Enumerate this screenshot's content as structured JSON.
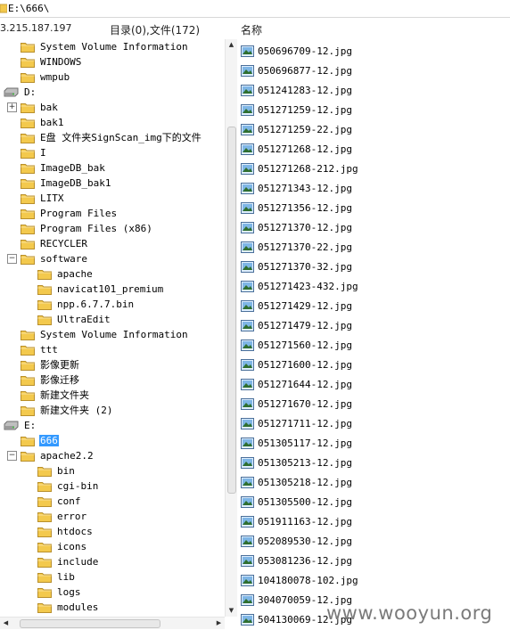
{
  "path_bar": {
    "path": "E:\\666\\"
  },
  "info": {
    "ip": "3.215.187.197",
    "dir_count": "目录(0),文件(172)",
    "column_name": "名称"
  },
  "tree": [
    {
      "label": "System Volume Information",
      "type": "folder",
      "level": 1
    },
    {
      "label": "WINDOWS",
      "type": "folder",
      "level": 1
    },
    {
      "label": "wmpub",
      "type": "folder",
      "level": 1
    },
    {
      "label": "D:",
      "type": "drive",
      "level": 0
    },
    {
      "label": "bak",
      "type": "folder",
      "level": 1,
      "expander": "+"
    },
    {
      "label": "bak1",
      "type": "folder",
      "level": 1
    },
    {
      "label": "E盘 文件夹SignScan_img下的文件",
      "type": "folder",
      "level": 1
    },
    {
      "label": "I",
      "type": "folder",
      "level": 1
    },
    {
      "label": "ImageDB_bak",
      "type": "folder",
      "level": 1
    },
    {
      "label": "ImageDB_bak1",
      "type": "folder",
      "level": 1
    },
    {
      "label": "LITX",
      "type": "folder",
      "level": 1
    },
    {
      "label": "Program Files",
      "type": "folder",
      "level": 1
    },
    {
      "label": "Program Files (x86)",
      "type": "folder",
      "level": 1
    },
    {
      "label": "RECYCLER",
      "type": "folder",
      "level": 1
    },
    {
      "label": "software",
      "type": "folder",
      "level": 1,
      "expander": "−"
    },
    {
      "label": "apache",
      "type": "folder",
      "level": 2
    },
    {
      "label": "navicat101_premium",
      "type": "folder",
      "level": 2
    },
    {
      "label": "npp.6.7.7.bin",
      "type": "folder",
      "level": 2
    },
    {
      "label": "UltraEdit",
      "type": "folder",
      "level": 2
    },
    {
      "label": "System Volume Information",
      "type": "folder",
      "level": 1
    },
    {
      "label": "ttt",
      "type": "folder",
      "level": 1
    },
    {
      "label": "影像更新",
      "type": "folder",
      "level": 1
    },
    {
      "label": "影像迁移",
      "type": "folder",
      "level": 1
    },
    {
      "label": "新建文件夹",
      "type": "folder",
      "level": 1
    },
    {
      "label": "新建文件夹 (2)",
      "type": "folder",
      "level": 1
    },
    {
      "label": "E:",
      "type": "drive",
      "level": 0
    },
    {
      "label": "666",
      "type": "folder",
      "level": 1,
      "selected": true
    },
    {
      "label": "apache2.2",
      "type": "folder",
      "level": 1,
      "expander": "−"
    },
    {
      "label": "bin",
      "type": "folder",
      "level": 2
    },
    {
      "label": "cgi-bin",
      "type": "folder",
      "level": 2
    },
    {
      "label": "conf",
      "type": "folder",
      "level": 2
    },
    {
      "label": "error",
      "type": "folder",
      "level": 2
    },
    {
      "label": "htdocs",
      "type": "folder",
      "level": 2
    },
    {
      "label": "icons",
      "type": "folder",
      "level": 2
    },
    {
      "label": "include",
      "type": "folder",
      "level": 2
    },
    {
      "label": "lib",
      "type": "folder",
      "level": 2
    },
    {
      "label": "logs",
      "type": "folder",
      "level": 2
    },
    {
      "label": "modules",
      "type": "folder",
      "level": 2
    }
  ],
  "files": [
    "050696709-12.jpg",
    "050696877-12.jpg",
    "051241283-12.jpg",
    "051271259-12.jpg",
    "051271259-22.jpg",
    "051271268-12.jpg",
    "051271268-212.jpg",
    "051271343-12.jpg",
    "051271356-12.jpg",
    "051271370-12.jpg",
    "051271370-22.jpg",
    "051271370-32.jpg",
    "051271423-432.jpg",
    "051271429-12.jpg",
    "051271479-12.jpg",
    "051271560-12.jpg",
    "051271600-12.jpg",
    "051271644-12.jpg",
    "051271670-12.jpg",
    "051271711-12.jpg",
    "051305117-12.jpg",
    "051305213-12.jpg",
    "051305218-12.jpg",
    "051305500-12.jpg",
    "051911163-12.jpg",
    "052089530-12.jpg",
    "053081236-12.jpg",
    "104180078-102.jpg",
    "304070059-12.jpg",
    "504130069-12.jpg"
  ],
  "scroll": {
    "up_arrow": "▲",
    "down_arrow": "▼",
    "left_arrow": "◀",
    "right_arrow": "▶"
  },
  "watermark": "www.wooyun.org",
  "colors": {
    "selection": "#3399ff",
    "folder": "#f3c94d",
    "image_icon": "#4a90c8"
  }
}
